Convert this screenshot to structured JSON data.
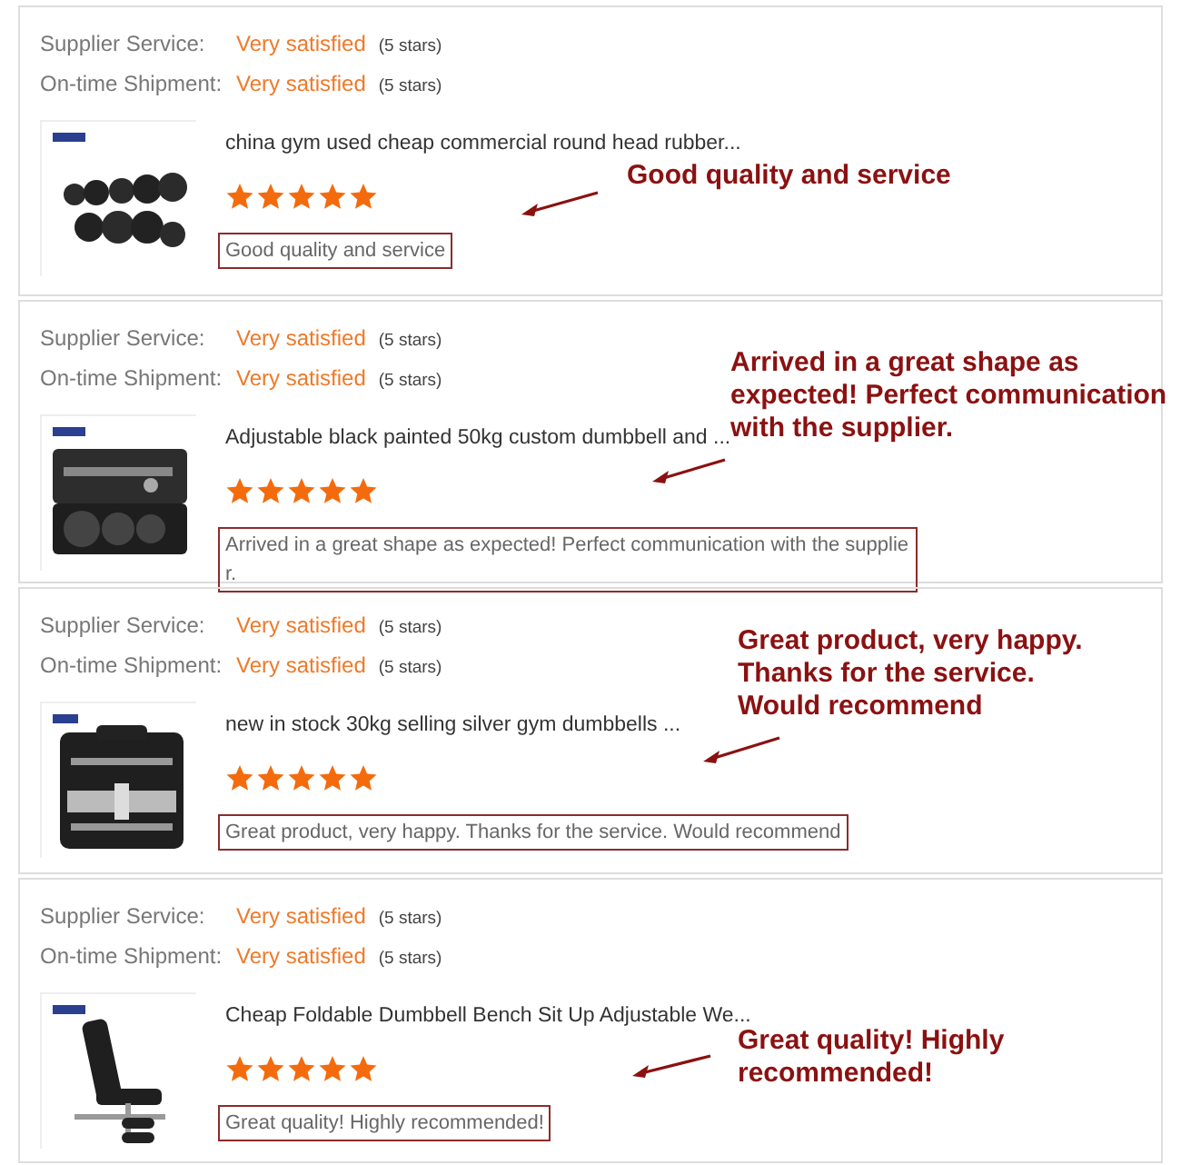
{
  "reviews": [
    {
      "ratings": [
        {
          "label": "Supplier Service:",
          "value": "Very satisfied",
          "stars_text": "(5 stars)"
        },
        {
          "label": "On-time Shipment:",
          "value": "Very satisfied",
          "stars_text": "(5 stars)"
        }
      ],
      "product": {
        "title": "china gym used cheap commercial round head rubber..."
      },
      "stars": 5,
      "comment": "Good quality and service",
      "annotation_lines": [
        "Good quality and service"
      ]
    },
    {
      "ratings": [
        {
          "label": "Supplier Service:",
          "value": "Very satisfied",
          "stars_text": "(5 stars)"
        },
        {
          "label": "On-time Shipment:",
          "value": "Very satisfied",
          "stars_text": "(5 stars)"
        }
      ],
      "product": {
        "title": "Adjustable black painted 50kg custom dumbbell and ..."
      },
      "stars": 5,
      "comment": "Arrived in a great shape as expected! Perfect communication with the supplier.",
      "annotation_lines": [
        "Arrived in a great shape as",
        "expected! Perfect communication",
        "with the supplier."
      ]
    },
    {
      "ratings": [
        {
          "label": "Supplier Service:",
          "value": "Very satisfied",
          "stars_text": "(5 stars)"
        },
        {
          "label": "On-time Shipment:",
          "value": "Very satisfied",
          "stars_text": "(5 stars)"
        }
      ],
      "product": {
        "title": "new in stock 30kg selling silver gym dumbbells ..."
      },
      "stars": 5,
      "comment": "Great product, very happy. Thanks for the service. Would recommend",
      "annotation_lines": [
        "Great product, very happy.",
        "Thanks for the service.",
        "Would recommend"
      ]
    },
    {
      "ratings": [
        {
          "label": "Supplier Service:",
          "value": "Very satisfied",
          "stars_text": "(5 stars)"
        },
        {
          "label": "On-time Shipment:",
          "value": "Very satisfied",
          "stars_text": "(5 stars)"
        }
      ],
      "product": {
        "title": "Cheap Foldable Dumbbell Bench Sit Up Adjustable We..."
      },
      "stars": 5,
      "comment": "Great quality! Highly recommended!",
      "annotation_lines": [
        "Great quality! Highly",
        "recommended!"
      ]
    }
  ]
}
